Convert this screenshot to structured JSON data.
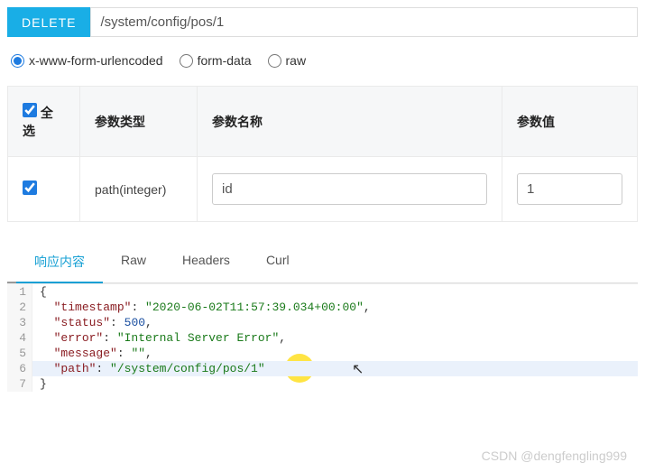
{
  "request": {
    "method": "DELETE",
    "url": "/system/config/pos/1"
  },
  "body_type": {
    "options": [
      "x-www-form-urlencoded",
      "form-data",
      "raw"
    ],
    "selected": "x-www-form-urlencoded"
  },
  "params_table": {
    "headers": {
      "select_all": "全选",
      "type": "参数类型",
      "name": "参数名称",
      "value": "参数值"
    },
    "rows": [
      {
        "checked": true,
        "type": "path(integer)",
        "name": "id",
        "value": "1"
      }
    ]
  },
  "response_tabs": {
    "items": [
      "响应内容",
      "Raw",
      "Headers",
      "Curl"
    ],
    "active": "响应内容"
  },
  "response_json": {
    "timestamp": "2020-06-02T11:57:39.034+00:00",
    "status": 500,
    "error": "Internal Server Error",
    "message": "",
    "path": "/system/config/pos/1"
  },
  "code_lines": {
    "l1": "{",
    "l2_k": "\"timestamp\"",
    "l2_v": "\"2020-06-02T11:57:39.034+00:00\"",
    "l3_k": "\"status\"",
    "l3_v": "500",
    "l4_k": "\"error\"",
    "l4_v": "\"Internal Server Error\"",
    "l5_k": "\"message\"",
    "l5_v": "\"\"",
    "l6_k": "\"path\"",
    "l6_v": "\"/system/config/pos/1\"",
    "l7": "}"
  },
  "watermark": "CSDN @dengfengling999"
}
